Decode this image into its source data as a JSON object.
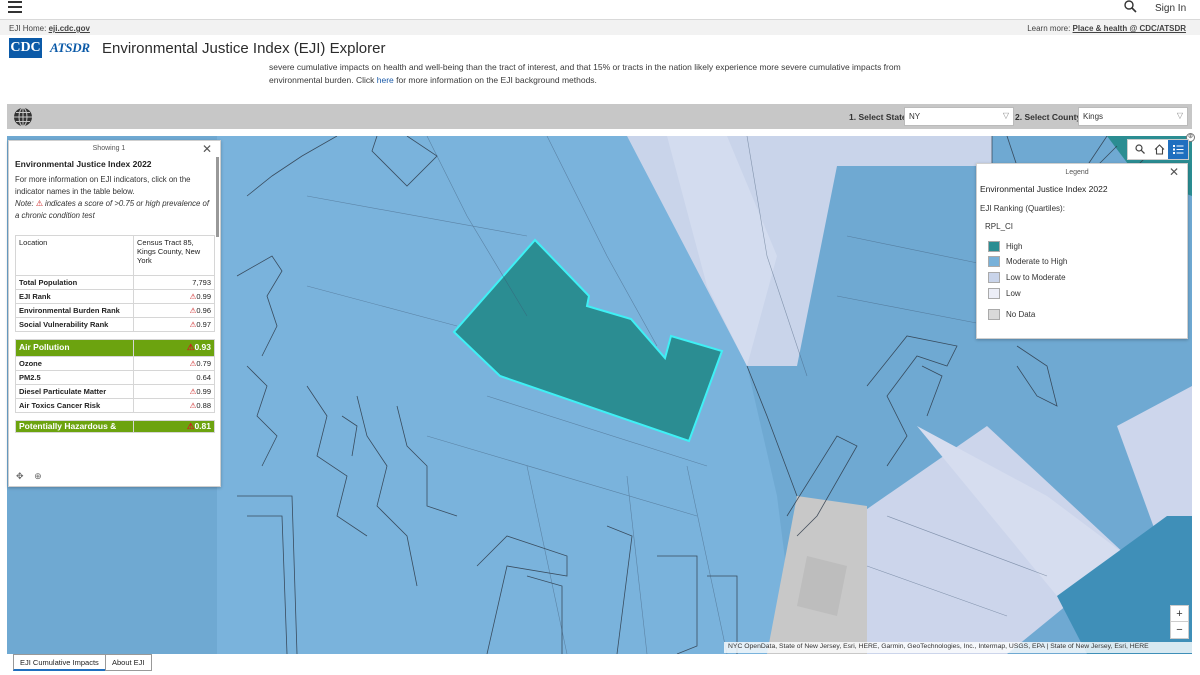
{
  "topbar": {
    "menu_icon": "hamburger-icon",
    "search_icon": "search-icon",
    "signin": "Sign In"
  },
  "cdcbar": {
    "home_prefix": "EJI Home: ",
    "home_link": "eji.cdc.gov",
    "learn_prefix": "Learn more: ",
    "learn_link": "Place & health @ CDC/ATSDR"
  },
  "header": {
    "logo_cdc": "CDC",
    "logo_atsdr": "ATSDR",
    "title": "Environmental Justice Index (EJI) Explorer",
    "intro_text": "severe cumulative impacts on health and well-being than the tract of interest, and that 15% or tracts in the nation likely experience more severe cumulative impacts from environmental burden. Click ",
    "intro_link": "here",
    "intro_tail": " for more information on the EJI background methods."
  },
  "selectors": {
    "state_label": "1. Select State",
    "state_value": "NY",
    "county_label": "2. Select County",
    "county_value": "Kings"
  },
  "info_panel": {
    "showing": "Showing 1",
    "title": "Environmental Justice Index 2022",
    "desc": "For more information on EJI indicators, click on the indicator names in the table below.",
    "note_prefix": "Note: ",
    "note_text": " indicates a score of >0.75 or high prevalence of a chronic condition test",
    "location_label": "Location",
    "location_value": "Census Tract 85, Kings County, New York",
    "rows": [
      {
        "label": "Total Population",
        "value": "7,793",
        "flag": false
      },
      {
        "label": "EJI Rank",
        "value": "0.99",
        "flag": true
      },
      {
        "label": "Environmental Burden Rank",
        "value": "0.96",
        "flag": true
      },
      {
        "label": "Social Vulnerability Rank",
        "value": "0.97",
        "flag": true
      }
    ],
    "section_air": {
      "label": "Air Pollution",
      "value": "0.93"
    },
    "air_rows": [
      {
        "label": "Ozone",
        "value": "0.79",
        "flag": true
      },
      {
        "label": "PM2.5",
        "value": "0.64",
        "flag": false
      },
      {
        "label": "Diesel Particulate Matter",
        "value": "0.99",
        "flag": true
      },
      {
        "label": "Air Toxics Cancer Risk",
        "value": "0.88",
        "flag": true
      }
    ],
    "section_next": {
      "label": "Potentially Hazardous &",
      "value": "0.81"
    }
  },
  "legend": {
    "header": "Legend",
    "title": "Environmental Justice Index 2022",
    "subtitle": "EJI Ranking (Quartiles):",
    "field": "RPL_CI",
    "items": [
      {
        "label": "High",
        "color": "#2b8d92"
      },
      {
        "label": "Moderate to High",
        "color": "#78b1d9"
      },
      {
        "label": "Low to Moderate",
        "color": "#c9d4ea"
      },
      {
        "label": "Low",
        "color": "#eceef7"
      },
      {
        "label": "No Data",
        "color": "#d9d9d9"
      }
    ]
  },
  "map": {
    "attribution": "NYC OpenData, State of New Jersey, Esri, HERE, Garmin, GeoTechnologies, Inc., Intermap, USGS, EPA | State of New Jersey, Esri, HERE",
    "zoom_in": "+",
    "zoom_out": "−"
  },
  "tabs": [
    {
      "label": "EJI Cumulative Impacts"
    },
    {
      "label": "About EJI"
    }
  ]
}
